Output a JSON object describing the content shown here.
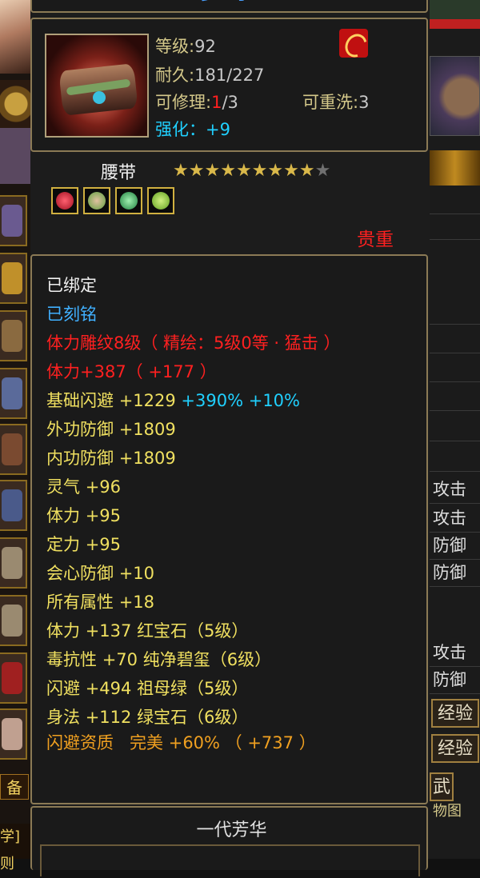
{
  "item": {
    "title_cut": "多 奇",
    "level_label": "等级",
    "level": "92",
    "durability_label": "耐久",
    "durability": "181/227",
    "repair_label": "可修理",
    "repair_used": "1",
    "repair_total": "/3",
    "reroll_label": "可重洗",
    "reroll": "3",
    "enhance_label": "强化：",
    "enhance": "+9",
    "name": "腰带",
    "stars_filled": 9,
    "stars_total": 10,
    "rarity": "贵重",
    "star_glyph": "★",
    "colors": {
      "gold_star": "#d9b84a",
      "grey_star": "#707070",
      "rarity": "#ff2020"
    },
    "gems": [
      {
        "name": "ruby-gem",
        "color": "#e02030"
      },
      {
        "name": "jade-gem",
        "color": "#60c040"
      },
      {
        "name": "emerald-gem",
        "color": "#30b060"
      },
      {
        "name": "green-gem",
        "color": "#80d030"
      }
    ]
  },
  "attributes": {
    "bound": "已绑定",
    "engraved": "已刻铭",
    "carve": "体力雕纹8级（ 精绘：5级0等 · 猛击 ）",
    "stamina_main": "体力+387（ +177 ）",
    "dodge_base_label": "基础闪避",
    "dodge_base_value": "+1229",
    "dodge_base_bonus": "+390% +10%",
    "lines": [
      {
        "label": "外功防御",
        "value": "+1809"
      },
      {
        "label": "内功防御",
        "value": "+1809"
      },
      {
        "label": "灵气",
        "value": "+96"
      },
      {
        "label": "体力",
        "value": "+95"
      },
      {
        "label": "定力",
        "value": "+95"
      },
      {
        "label": "会心防御",
        "value": "+10"
      },
      {
        "label": "所有属性",
        "value": "+18"
      },
      {
        "label": "体力",
        "value": "+137",
        "gem": "红宝石（5级）"
      },
      {
        "label": "毒抗性",
        "value": "+70",
        "gem": "纯净碧玺（6级）"
      },
      {
        "label": "闪避",
        "value": "+494",
        "gem": "祖母绿（5级）"
      },
      {
        "label": "身法",
        "value": "+112",
        "gem": "绿宝石（6级）"
      }
    ],
    "quality_label": "闪避资质",
    "quality_grade": "完美",
    "quality_value": "+60% （ +737 ）"
  },
  "footer": {
    "set_name": "一代芳华"
  },
  "left_panel": {
    "equip_label": "备",
    "bottom_label": "学]则"
  },
  "right_panel": {
    "items": [
      "攻击",
      "攻击",
      "防御",
      "防御",
      "攻击",
      "防御"
    ],
    "exp_button_1": "经验",
    "exp_button_2": "经验",
    "tab_label": "武",
    "bottom_label": "物图"
  }
}
